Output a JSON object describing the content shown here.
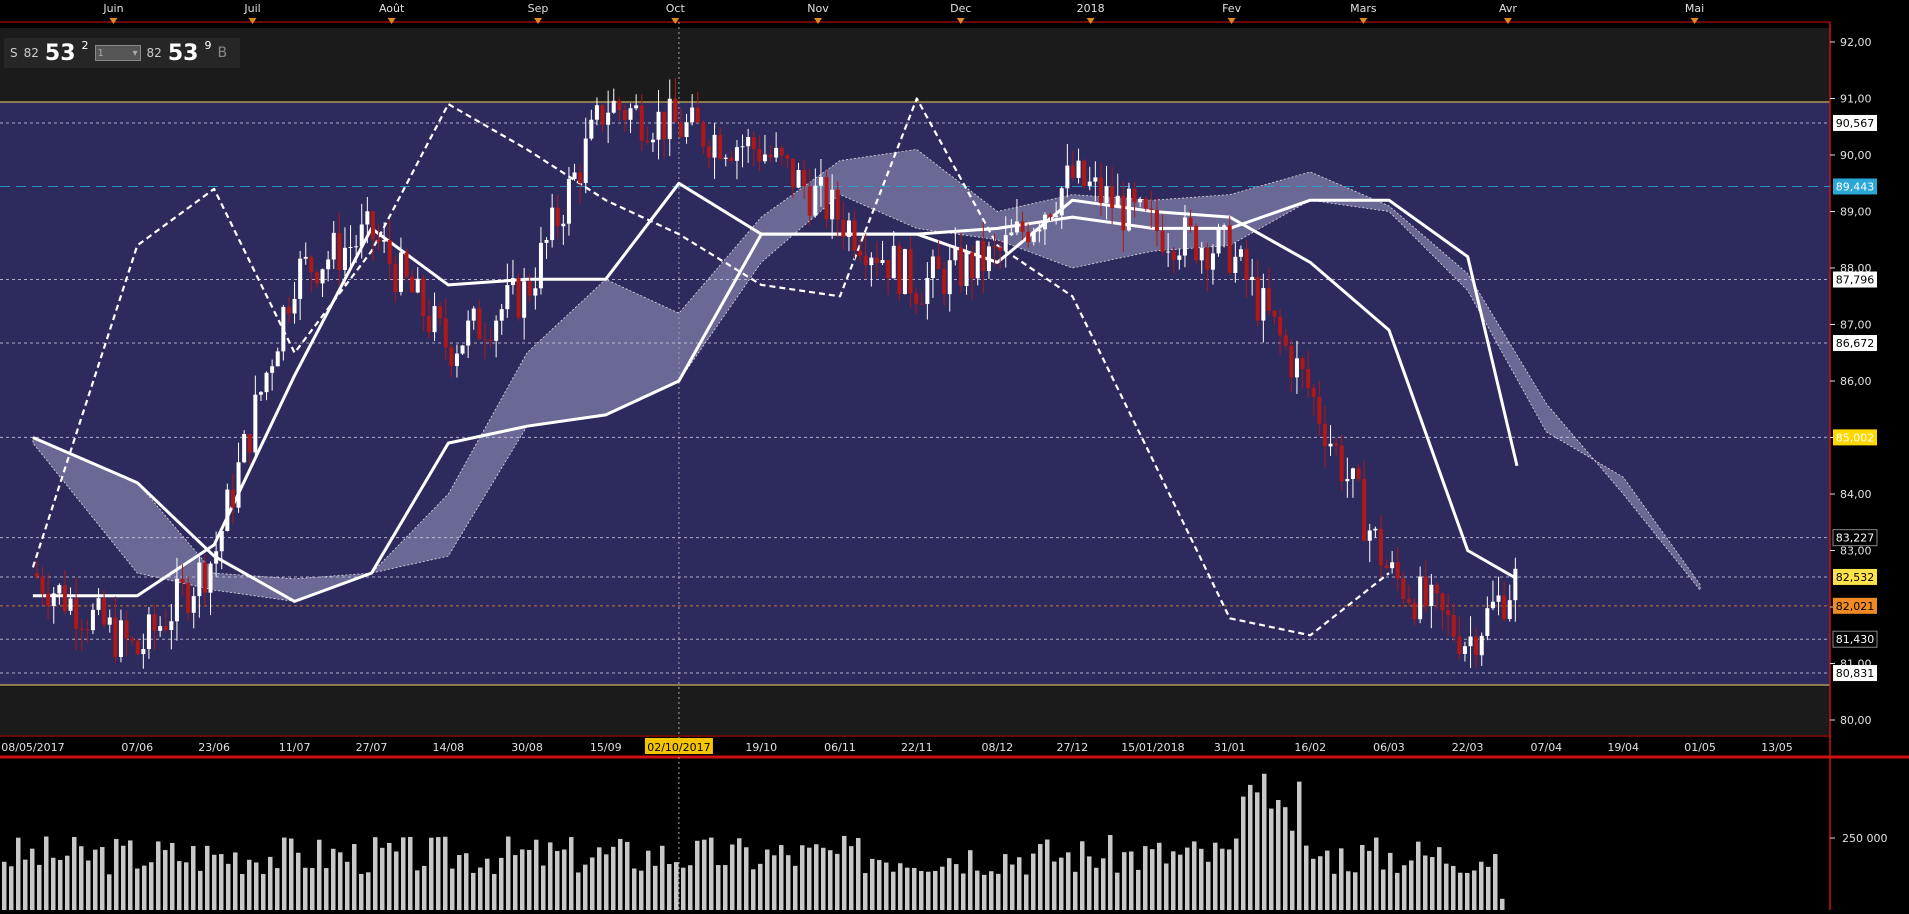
{
  "quote": {
    "side_left": "S",
    "bid_prefix": "82",
    "bid_main": "53",
    "bid_sup": "2",
    "quantity": "1",
    "ask_prefix": "82",
    "ask_main": "53",
    "ask_sup": "9",
    "side_right": "B"
  },
  "months": [
    {
      "label": "Juin",
      "pos": 0.062
    },
    {
      "label": "Juil",
      "pos": 0.138
    },
    {
      "label": "Août",
      "pos": 0.214
    },
    {
      "label": "Sep",
      "pos": 0.294
    },
    {
      "label": "Oct",
      "pos": 0.369
    },
    {
      "label": "Nov",
      "pos": 0.447
    },
    {
      "label": "Dec",
      "pos": 0.525
    },
    {
      "label": "2018",
      "pos": 0.596
    },
    {
      "label": "Fev",
      "pos": 0.673
    },
    {
      "label": "Mars",
      "pos": 0.745
    },
    {
      "label": "Avr",
      "pos": 0.824
    },
    {
      "label": "Mai",
      "pos": 0.926
    }
  ],
  "date_ticks": [
    {
      "label": "08/05/2017",
      "pos": 0.018
    },
    {
      "label": "07/06",
      "pos": 0.075
    },
    {
      "label": "23/06",
      "pos": 0.117
    },
    {
      "label": "11/07",
      "pos": 0.161
    },
    {
      "label": "27/07",
      "pos": 0.203
    },
    {
      "label": "14/08",
      "pos": 0.245
    },
    {
      "label": "30/08",
      "pos": 0.288
    },
    {
      "label": "15/09",
      "pos": 0.331
    },
    {
      "label": "02/10/2017",
      "pos": 0.371,
      "highlight": true
    },
    {
      "label": "19/10",
      "pos": 0.416
    },
    {
      "label": "06/11",
      "pos": 0.459
    },
    {
      "label": "22/11",
      "pos": 0.501
    },
    {
      "label": "08/12",
      "pos": 0.545
    },
    {
      "label": "27/12",
      "pos": 0.586
    },
    {
      "label": "15/01/2018",
      "pos": 0.63
    },
    {
      "label": "31/01",
      "pos": 0.672
    },
    {
      "label": "16/02",
      "pos": 0.716
    },
    {
      "label": "06/03",
      "pos": 0.759
    },
    {
      "label": "22/03",
      "pos": 0.802
    },
    {
      "label": "07/04",
      "pos": 0.845
    },
    {
      "label": "19/04",
      "pos": 0.887
    },
    {
      "label": "01/05",
      "pos": 0.929
    },
    {
      "label": "13/05",
      "pos": 0.971
    }
  ],
  "price_ticks": [
    "92,00",
    "91,00",
    "90,00",
    "89,00",
    "88,00",
    "87,00",
    "86,00",
    "85,00",
    "84,00",
    "83,00",
    "82,00",
    "81,00",
    "80,00"
  ],
  "price_markers": [
    {
      "value": 90.567,
      "label": "90,567",
      "bg": "#ffffff",
      "fg": "#000000"
    },
    {
      "value": 89.443,
      "label": "89,443",
      "bg": "#2aa7d6",
      "fg": "#ffffff"
    },
    {
      "value": 87.796,
      "label": "87,796",
      "bg": "#ffffff",
      "fg": "#000000"
    },
    {
      "value": 86.672,
      "label": "86,672",
      "bg": "#ffffff",
      "fg": "#000000"
    },
    {
      "value": 85.002,
      "label": "85,002",
      "bg": "#ffd700",
      "fg": "#ffffff"
    },
    {
      "value": 83.227,
      "label": "83,227",
      "bg": "#000000",
      "fg": "#ffffff"
    },
    {
      "value": 82.532,
      "label": "82,532",
      "bg": "#ffe14a",
      "fg": "#000000"
    },
    {
      "value": 82.021,
      "label": "82,021",
      "bg": "#f08a24",
      "fg": "#000000"
    },
    {
      "value": 81.43,
      "label": "81,430",
      "bg": "#000000",
      "fg": "#ffffff"
    },
    {
      "value": 80.831,
      "label": "80,831",
      "bg": "#ffffff",
      "fg": "#000000"
    }
  ],
  "volume_axis_label": "250 000",
  "colors": {
    "plot_bg": "#2d2a5e",
    "band_bg": "#1b1b1b",
    "cloud": "#9d9dc2",
    "bear": "#b01818",
    "bull": "#ffffff",
    "accent_red": "#d01010",
    "volume": "#c8c8c8"
  },
  "chart_data": {
    "type": "candlestick",
    "instrument_note": "",
    "ylim": [
      80.0,
      92.0
    ],
    "y_scale": "linear",
    "grid": false,
    "date_range": [
      "08/05/2017",
      "13/05/2018"
    ],
    "last_price": 82.532,
    "cross_hair_date": "02/10/2017",
    "series": [
      {
        "name": "",
        "kind": "close_approx",
        "style": "candles",
        "x": [
          "08/05/2017",
          "07/06",
          "23/06",
          "11/07",
          "27/07",
          "14/08",
          "30/08",
          "15/09",
          "02/10/2017",
          "19/10",
          "06/11",
          "22/11",
          "08/12",
          "27/12",
          "15/01/2018",
          "31/01",
          "16/02",
          "06/03",
          "22/03",
          "01/04"
        ],
        "values": [
          82.6,
          81.2,
          82.9,
          87.9,
          88.6,
          86.6,
          87.6,
          90.9,
          90.5,
          90.1,
          88.9,
          87.7,
          88.2,
          89.6,
          88.7,
          88.3,
          85.8,
          82.6,
          81.4,
          82.5
        ]
      },
      {
        "name": "",
        "kind": "lagging_line",
        "style": "dashed",
        "x": [
          "08/05/2017",
          "07/06",
          "23/06",
          "11/07",
          "27/07",
          "14/08",
          "30/08",
          "15/09",
          "02/10/2017",
          "19/10",
          "06/11",
          "22/11",
          "08/12",
          "27/12",
          "15/01/2018",
          "31/01",
          "16/02",
          "06/03"
        ],
        "values": [
          82.7,
          88.4,
          89.4,
          86.5,
          88.3,
          90.9,
          90.1,
          89.2,
          88.6,
          87.7,
          87.5,
          91.0,
          88.4,
          87.5,
          84.6,
          81.8,
          81.5,
          82.6
        ]
      },
      {
        "name": "",
        "kind": "thick_line_1",
        "style": "solid",
        "x": [
          "08/05/2017",
          "07/06",
          "23/06",
          "11/07",
          "27/07",
          "14/08",
          "30/08",
          "15/09",
          "02/10/2017",
          "19/10",
          "06/11",
          "22/11",
          "08/12",
          "27/12",
          "15/01/2018",
          "31/01",
          "16/02",
          "06/03",
          "22/03",
          "01/04"
        ],
        "values": [
          82.2,
          82.2,
          83.1,
          86.1,
          88.7,
          87.7,
          87.8,
          87.8,
          89.5,
          88.6,
          88.6,
          88.6,
          88.1,
          89.2,
          89.0,
          88.9,
          88.1,
          86.9,
          83.0,
          82.5
        ]
      },
      {
        "name": "",
        "kind": "thick_line_2",
        "style": "solid",
        "x": [
          "08/05/2017",
          "07/06",
          "23/06",
          "11/07",
          "27/07",
          "14/08",
          "30/08",
          "15/09",
          "02/10/2017",
          "19/10",
          "06/11",
          "22/11",
          "08/12",
          "27/12",
          "15/01/2018",
          "31/01",
          "16/02",
          "06/03",
          "22/03",
          "01/04"
        ],
        "values": [
          85.0,
          84.2,
          82.9,
          82.1,
          82.6,
          84.9,
          85.2,
          85.4,
          86.0,
          88.6,
          88.6,
          88.6,
          88.7,
          88.9,
          88.7,
          88.7,
          89.2,
          89.2,
          88.2,
          84.5
        ]
      },
      {
        "name": "",
        "kind": "cloud",
        "style": "filled",
        "x": [
          "08/05/2017",
          "07/06",
          "23/06",
          "11/07",
          "27/07",
          "14/08",
          "30/08",
          "15/09",
          "02/10/2017",
          "19/10",
          "06/11",
          "22/11",
          "08/12",
          "27/12",
          "15/01/2018",
          "31/01",
          "16/02",
          "06/03",
          "22/03",
          "07/04",
          "19/04",
          "01/05"
        ],
        "upper": [
          85.0,
          84.2,
          82.6,
          82.5,
          82.6,
          84.0,
          86.5,
          87.8,
          87.2,
          88.9,
          89.9,
          90.1,
          89.0,
          89.3,
          89.2,
          89.3,
          89.7,
          89.1,
          87.9,
          85.6,
          84.0,
          82.3
        ],
        "lower": [
          84.9,
          82.6,
          82.3,
          82.1,
          82.6,
          82.9,
          85.2,
          85.4,
          86.0,
          88.1,
          89.3,
          88.7,
          88.5,
          88.0,
          88.3,
          88.4,
          89.2,
          89.0,
          87.6,
          85.1,
          84.3,
          82.4
        ]
      }
    ]
  }
}
